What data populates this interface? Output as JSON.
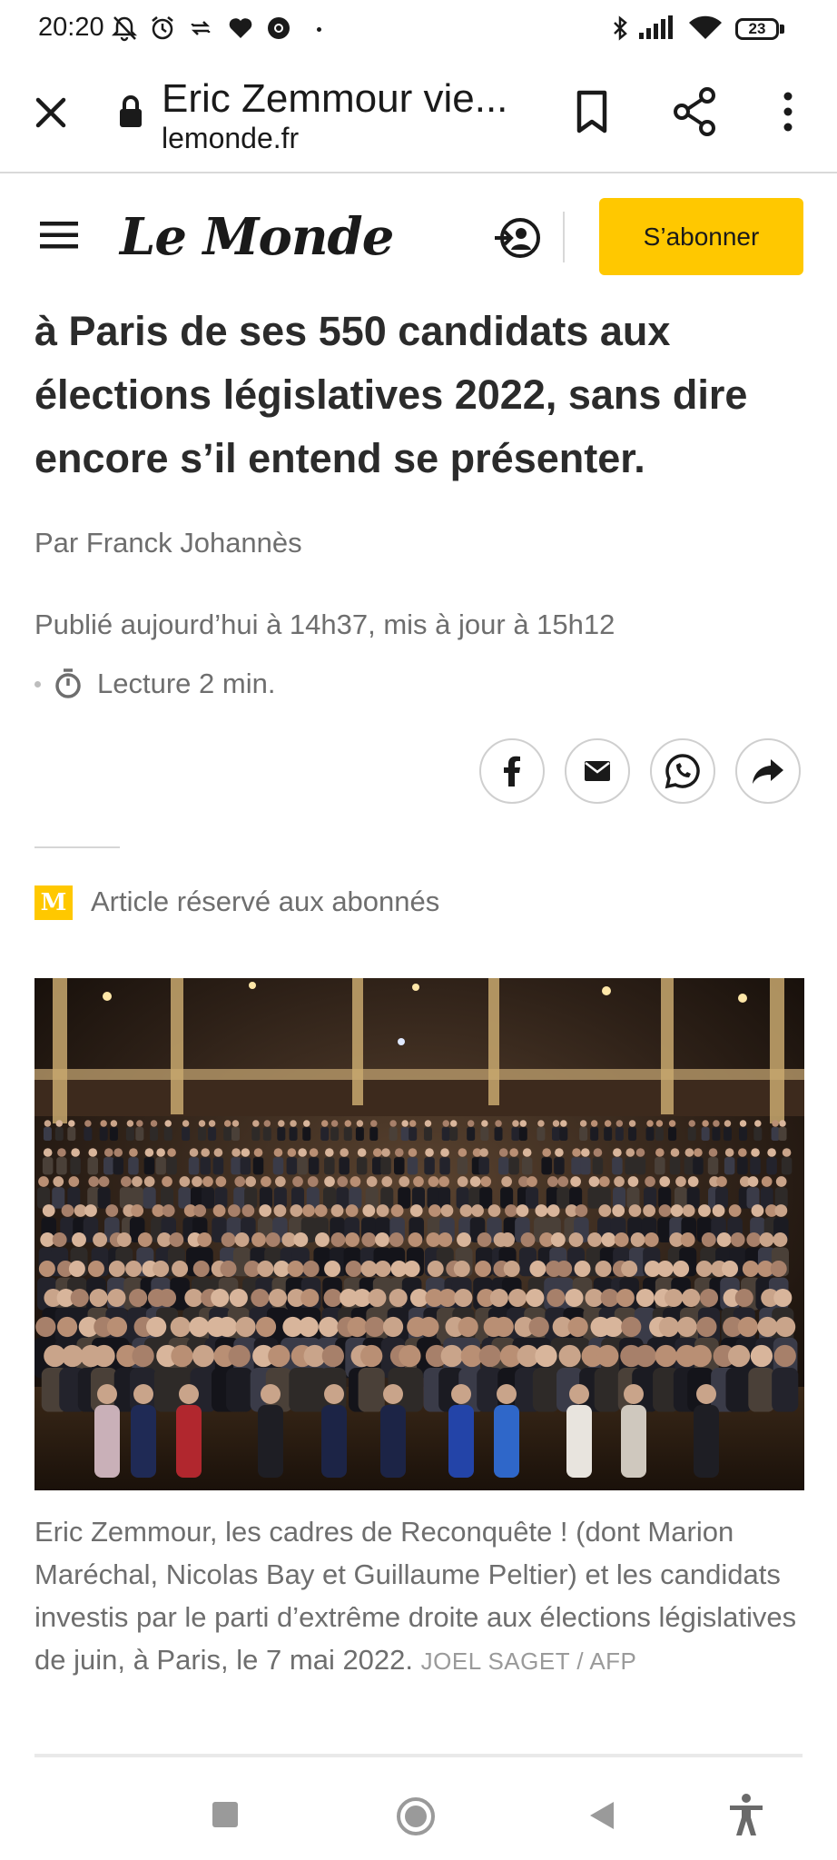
{
  "status_bar": {
    "time": "20:20",
    "battery": "23",
    "icons": [
      "bell-off-icon",
      "alarm-icon",
      "sync-icon",
      "heart-icon",
      "chrome-icon",
      "bluetooth-icon",
      "signal-icon",
      "wifi-icon",
      "battery-icon"
    ]
  },
  "browser": {
    "title": "Eric Zemmour vie...",
    "domain": "lemonde.fr",
    "icons": [
      "close-icon",
      "lock-icon",
      "bookmark-icon",
      "share-icon",
      "more-icon"
    ]
  },
  "site_header": {
    "logo": "Le Monde",
    "subscribe_label": "S’abonner",
    "icons": [
      "menu-icon",
      "account-icon"
    ]
  },
  "article": {
    "headline": "à Paris de ses 550 candidats aux élections législatives 2022, sans dire encore s’il entend se présenter.",
    "byline": "Par Franck Johannès",
    "published": "Publié aujourd’hui à 14h37, mis à jour à 15h12",
    "reading_time": "Lecture 2 min.",
    "share_buttons": [
      "facebook-icon",
      "mail-icon",
      "whatsapp-icon",
      "forward-share-icon"
    ],
    "premium_badge": "M",
    "premium_label": "Article réservé aux abonnés",
    "caption": "Eric Zemmour, les cadres de Reconquête ! (dont Marion Maréchal, Nicolas Bay et Guillaume Peltier) et les candidats investis par le parti d’extrême droite aux élections législatives de juin, à Paris, le 7 mai 2022.",
    "credit": "JOEL SAGET / AFP"
  },
  "colors": {
    "accent": "#ffc800",
    "text": "#2b2b2b",
    "muted": "#6e6e6e"
  },
  "nav_bar": {
    "icons": [
      "recents-square-icon",
      "home-circle-icon",
      "back-triangle-icon",
      "accessibility-icon"
    ]
  }
}
